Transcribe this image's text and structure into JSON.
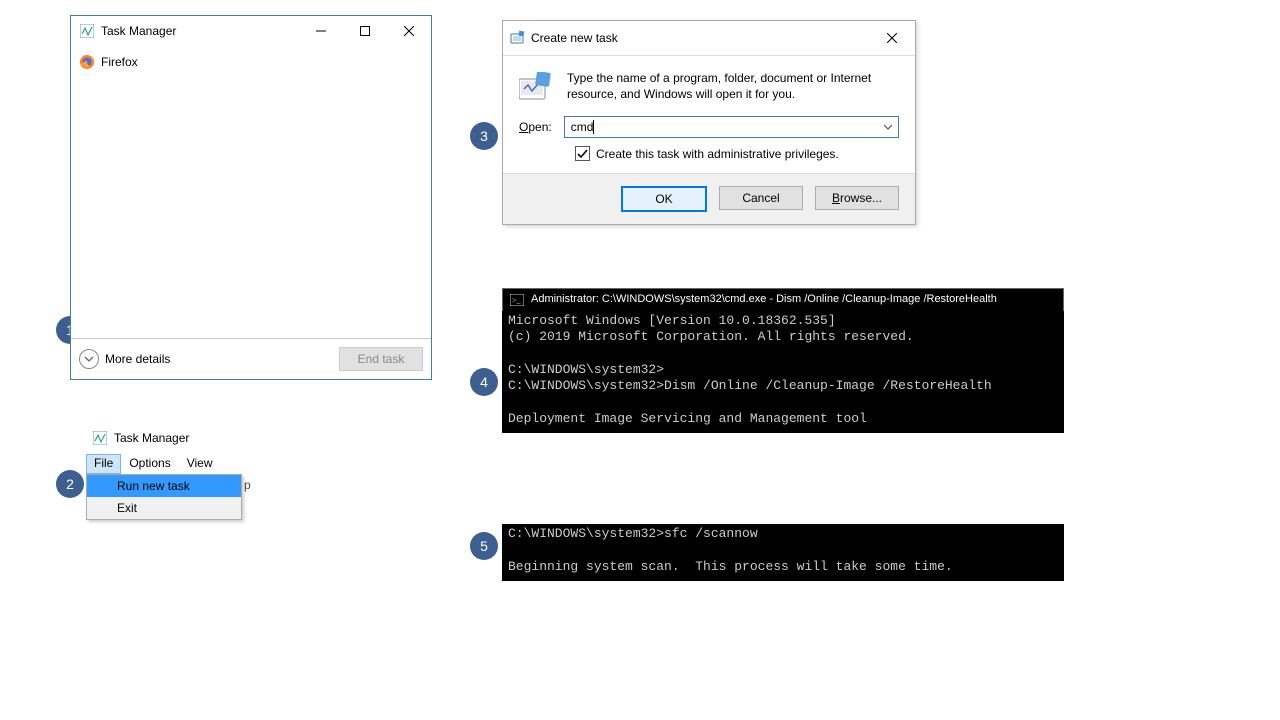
{
  "badges": {
    "b1": "1",
    "b2": "2",
    "b3": "3",
    "b4": "4",
    "b5": "5"
  },
  "step1": {
    "title": "Task Manager",
    "process0": "Firefox",
    "more_details": "More details",
    "end_task": "End task"
  },
  "step2": {
    "title": "Task Manager",
    "menu": {
      "file": "File",
      "options": "Options",
      "view": "View"
    },
    "dropdown": {
      "run_new_task": "Run new task",
      "exit": "Exit"
    },
    "peek": "p"
  },
  "step3": {
    "title": "Create new task",
    "instruction": "Type the name of a program, folder, document or Internet resource, and Windows will open it for you.",
    "open_label": "Open:",
    "open_value": "cmd",
    "admin_label": "Create this task with administrative privileges.",
    "buttons": {
      "ok": "OK",
      "cancel": "Cancel",
      "browse": "Browse..."
    }
  },
  "step4": {
    "title": "Administrator: C:\\WINDOWS\\system32\\cmd.exe - Dism  /Online /Cleanup-Image /RestoreHealth",
    "lines": [
      "Microsoft Windows [Version 10.0.18362.535]",
      "(c) 2019 Microsoft Corporation. All rights reserved.",
      "",
      "C:\\WINDOWS\\system32>",
      "C:\\WINDOWS\\system32>Dism /Online /Cleanup-Image /RestoreHealth",
      "",
      "Deployment Image Servicing and Management tool"
    ]
  },
  "step5": {
    "lines": [
      "C:\\WINDOWS\\system32>sfc /scannow",
      "",
      "Beginning system scan.  This process will take some time."
    ]
  }
}
